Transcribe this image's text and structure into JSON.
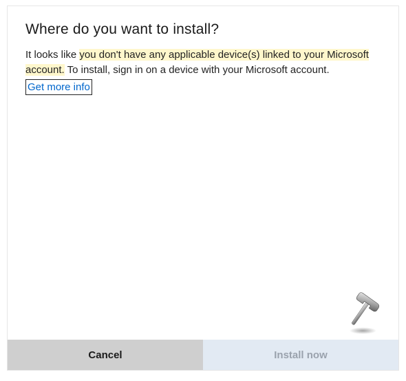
{
  "dialog": {
    "title": "Where do you want to install?",
    "message_prefix": "It looks like ",
    "message_highlight": "you don't have any applicable device(s) linked to your Microsoft account.",
    "message_suffix": " To install, sign in on a device with your Microsoft account.",
    "link_label": "Get more info"
  },
  "buttons": {
    "cancel": "Cancel",
    "install": "Install now"
  }
}
